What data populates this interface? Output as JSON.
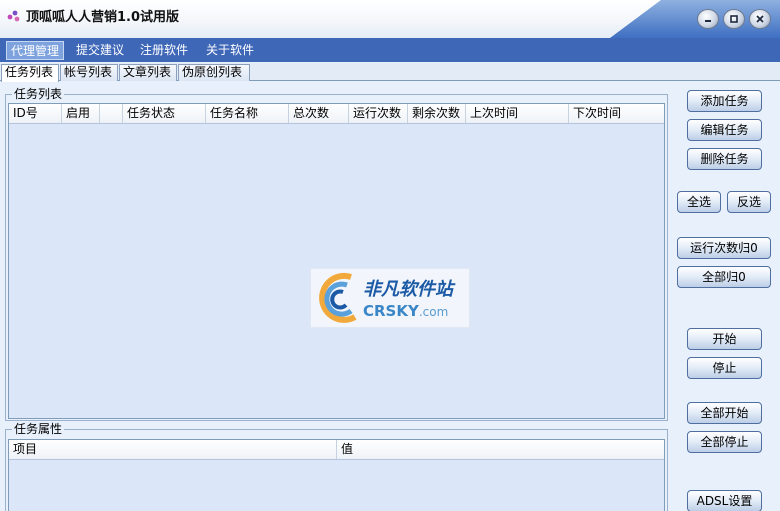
{
  "window": {
    "title": "顶呱呱人人营销1.0试用版"
  },
  "menu": [
    "代理管理",
    "提交建议",
    "注册软件",
    "关于软件"
  ],
  "tabs": [
    "任务列表",
    "帐号列表",
    "文章列表",
    "伪原创列表"
  ],
  "task_list": {
    "group_label": "任务列表",
    "columns": [
      "ID号",
      "启用",
      "",
      "任务状态",
      "任务名称",
      "总次数",
      "运行次数",
      "剩余次数",
      "上次时间",
      "下次时间"
    ]
  },
  "task_props": {
    "group_label": "任务属性",
    "columns": [
      "项目",
      "值"
    ]
  },
  "watermark": {
    "cn": "非凡软件站",
    "en": "CRSKY",
    "domain": ".com"
  },
  "buttons": {
    "add_task": "添加任务",
    "edit_task": "编辑任务",
    "delete_task": "删除任务",
    "select_all": "全选",
    "invert_select": "反选",
    "reset_run_count": "运行次数归0",
    "reset_all": "全部归0",
    "start": "开始",
    "stop": "停止",
    "start_all": "全部开始",
    "stop_all": "全部停止",
    "adsl_settings": "ADSL设置"
  }
}
